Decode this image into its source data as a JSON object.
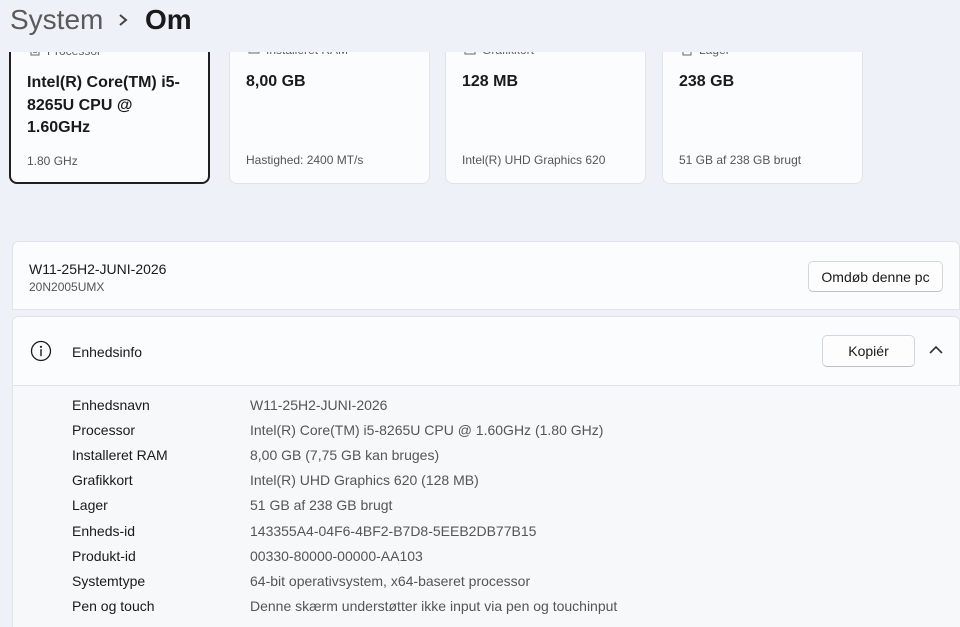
{
  "breadcrumb": {
    "root": "System",
    "current": "Om"
  },
  "specs": [
    {
      "label": "Processor",
      "icon": "processor-icon",
      "value": "Intel(R) Core(TM) i5-8265U CPU @ 1.60GHz",
      "sub": "1.80 GHz"
    },
    {
      "label": "Installeret RAM",
      "icon": "ram-icon",
      "value": "8,00 GB",
      "sub": "Hastighed: 2400 MT/s"
    },
    {
      "label": "Grafikkort",
      "icon": "graphics-card-icon",
      "value": "128 MB",
      "sub": "Intel(R) UHD Graphics 620"
    },
    {
      "label": "Lager",
      "icon": "storage-icon",
      "value": "238 GB",
      "sub": "51 GB af 238 GB brugt"
    }
  ],
  "pc": {
    "name": "W11-25H2-JUNI-2026",
    "model": "20N2005UMX",
    "rename_label": "Omdøb denne pc"
  },
  "device_info": {
    "title": "Enhedsinfo",
    "copy_label": "Kopiér",
    "rows": [
      {
        "key": "Enhedsnavn",
        "value": "W11-25H2-JUNI-2026"
      },
      {
        "key": "Processor",
        "value": "Intel(R) Core(TM) i5-8265U CPU @ 1.60GHz   (1.80 GHz)"
      },
      {
        "key": "Installeret RAM",
        "value": "8,00 GB (7,75 GB kan bruges)"
      },
      {
        "key": "Grafikkort",
        "value": "Intel(R) UHD Graphics 620 (128 MB)"
      },
      {
        "key": "Lager",
        "value": "51 GB af 238 GB brugt"
      },
      {
        "key": "Enheds-id",
        "value": "143355A4-04F6-4BF2-B7D8-5EEB2DB77B15"
      },
      {
        "key": "Produkt-id",
        "value": "00330-80000-00000-AA103"
      },
      {
        "key": "Systemtype",
        "value": "64-bit operativsystem, x64-baseret processor"
      },
      {
        "key": "Pen og touch",
        "value": "Denne skærm understøtter ikke input via pen og touchinput"
      }
    ]
  }
}
